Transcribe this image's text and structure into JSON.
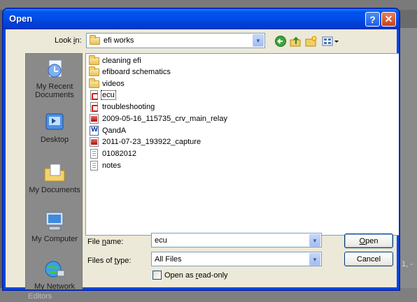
{
  "window": {
    "title": "Open",
    "help_glyph": "?",
    "close_glyph": "✕"
  },
  "lookin": {
    "label": "Look in:",
    "label_prefix": "Look ",
    "label_accel": "i",
    "label_suffix": "n:",
    "value": "efi works"
  },
  "toolbar": [
    "back-icon",
    "up-folder-icon",
    "new-folder-icon",
    "views-menu-icon"
  ],
  "places": [
    {
      "label_line1": "My Recent",
      "label_line2": "Documents",
      "icon": "recent-documents-icon"
    },
    {
      "label_line1": "Desktop",
      "label_line2": "",
      "icon": "desktop-icon"
    },
    {
      "label_line1": "My Documents",
      "label_line2": "",
      "icon": "my-documents-icon"
    },
    {
      "label_line1": "My Computer",
      "label_line2": "",
      "icon": "my-computer-icon"
    },
    {
      "label_line1": "My Network",
      "label_line2": "",
      "icon": "my-network-icon"
    }
  ],
  "files": [
    {
      "name": "cleaning efi",
      "type": "folder"
    },
    {
      "name": "efiboard schematics",
      "type": "folder"
    },
    {
      "name": "videos",
      "type": "folder"
    },
    {
      "name": "ecu",
      "type": "pdf",
      "selected": true
    },
    {
      "name": "troubleshooting",
      "type": "pdf"
    },
    {
      "name": "2009-05-16_115735_crv_main_relay",
      "type": "image"
    },
    {
      "name": "QandA",
      "type": "word"
    },
    {
      "name": "2011-07-23_193922_capture",
      "type": "image"
    },
    {
      "name": "01082012",
      "type": "text"
    },
    {
      "name": "notes",
      "type": "text"
    }
  ],
  "filename": {
    "label_prefix": "File ",
    "label_accel": "n",
    "label_suffix": "ame:",
    "value": "ecu"
  },
  "filetype": {
    "label_prefix": "Files of ",
    "label_accel": "t",
    "label_suffix": "ype:",
    "value": "All Files"
  },
  "readonly": {
    "label_prefix": "Open as ",
    "label_accel": "r",
    "label_suffix": "ead-only",
    "checked": false
  },
  "buttons": {
    "open_accel": "O",
    "open_rest": "pen",
    "cancel": "Cancel"
  },
  "background": {
    "right_text": "1, -",
    "bottom_text": "Editors"
  }
}
